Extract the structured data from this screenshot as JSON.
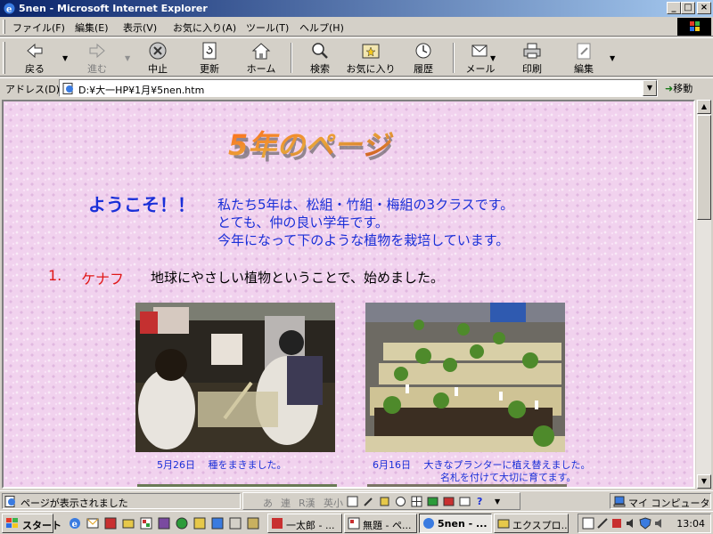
{
  "window": {
    "title": "5nen - Microsoft Internet Explorer",
    "min_btn": "_",
    "max_btn": "□",
    "close_btn": "×"
  },
  "menu": {
    "items": [
      "ファイル(F)",
      "編集(E)",
      "表示(V)",
      "お気に入り(A)",
      "ツール(T)",
      "ヘルプ(H)"
    ]
  },
  "toolbar": {
    "back": "戻る",
    "forward": "進む",
    "stop": "中止",
    "refresh": "更新",
    "home": "ホーム",
    "search": "検索",
    "favorites": "お気に入り",
    "history": "履歴",
    "mail": "メール",
    "print": "印刷",
    "edit": "編集"
  },
  "address": {
    "label": "アドレス(D)",
    "value": "D:¥大一HP¥1月¥5nen.htm",
    "go": "移動"
  },
  "page": {
    "title_art": "5年のページ",
    "welcome": "ようこそ！！",
    "intro_lines": [
      "私たち5年は、松組・竹組・梅組の3クラスです。",
      "とても、仲の良い学年です。",
      "今年になって下のような植物を栽培しています。"
    ],
    "section": {
      "number": "1.",
      "name": "ケナフ",
      "description": "地球にやさしい植物ということで、始めました。"
    },
    "photos": [
      {
        "caption_lines": [
          "5月26日　 種をまきました。"
        ]
      },
      {
        "caption_lines": [
          "6月16日　 大きなプランターに植え替えました。",
          "名札を付けて大切に育てます。"
        ]
      }
    ]
  },
  "status": {
    "text": "ページが表示されました",
    "ime": [
      "あ",
      "連",
      "R漢",
      "英小"
    ],
    "zone": "マイ コンピュータ"
  },
  "taskbar": {
    "start": "スタート",
    "tasks": [
      "一太郎 - ...",
      "無題 - ペ...",
      "5nen - ...",
      "エクスプロ..."
    ],
    "active_index": 2,
    "clock": "13:04"
  }
}
